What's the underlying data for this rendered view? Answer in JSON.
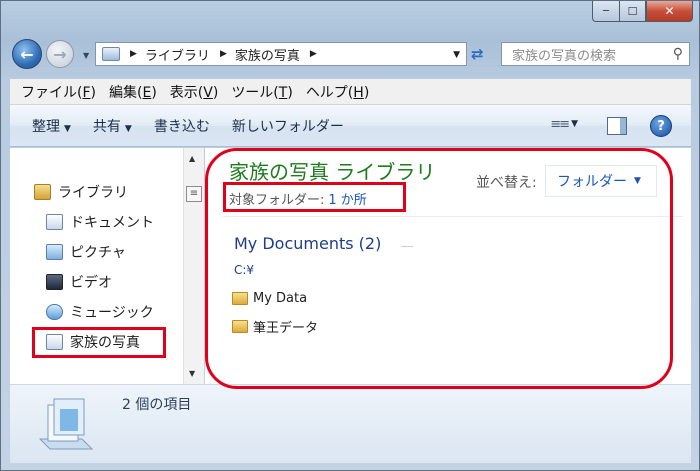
{
  "window": {
    "minimize_glyph": "─",
    "maximize_glyph": "☐",
    "close_glyph": "✕"
  },
  "address": {
    "crumbs": [
      "ライブラリ",
      "家族の写真"
    ],
    "search_placeholder": "家族の写真の検索"
  },
  "menu": {
    "items": [
      {
        "label": "ファイル(",
        "key": "F",
        "end": ")"
      },
      {
        "label": "編集(",
        "key": "E",
        "end": ")"
      },
      {
        "label": "表示(",
        "key": "V",
        "end": ")"
      },
      {
        "label": "ツール(",
        "key": "T",
        "end": ")"
      },
      {
        "label": "ヘルプ(",
        "key": "H",
        "end": ")"
      }
    ]
  },
  "toolbar": {
    "organize": "整理",
    "share": "共有",
    "burn": "書き込む",
    "new_folder": "新しいフォルダー",
    "help_glyph": "?"
  },
  "nav": {
    "items": [
      "ライブラリ",
      "ドキュメント",
      "ピクチャ",
      "ビデオ",
      "ミュージック",
      "家族の写真"
    ]
  },
  "library": {
    "title": "家族の写真 ライブラリ",
    "scope_label": "対象フォルダー:",
    "scope_link": "1 か所",
    "arrange_label": "並べ替え:",
    "arrange_value": "フォルダー",
    "group_name": "My Documents (2)",
    "group_path": "C:¥",
    "files": [
      "My Data",
      "筆王データ"
    ]
  },
  "details": {
    "count": "2 個の項目"
  },
  "colors": {
    "highlight": "#e0001b",
    "library_title": "#1e7b1e",
    "link": "#1a56b8"
  }
}
